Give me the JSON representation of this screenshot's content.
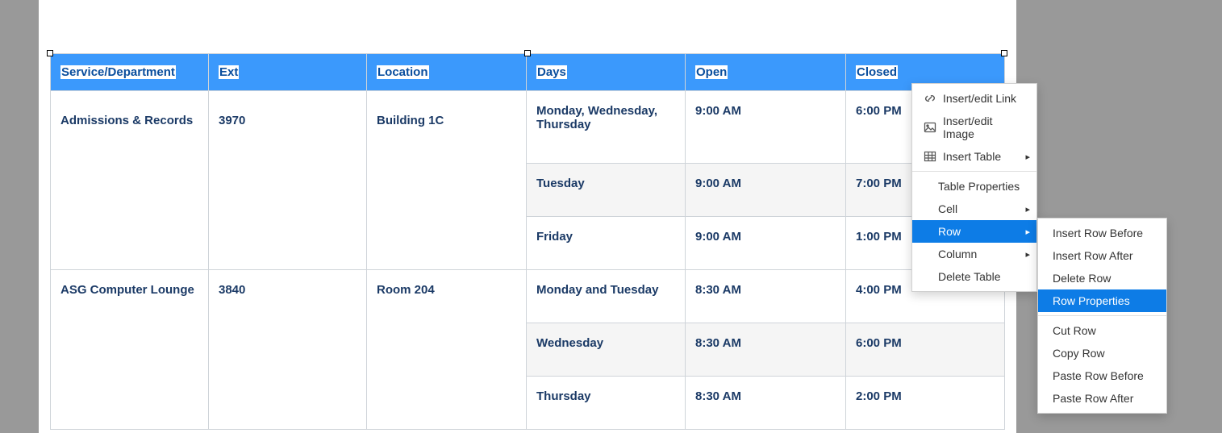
{
  "table": {
    "headers": [
      "Service/Department",
      "Ext",
      "Location",
      "Days",
      "Open",
      "Closed"
    ],
    "rows": [
      {
        "service": "Admissions & Records",
        "ext": "3970",
        "location": "Building 1C",
        "schedules": [
          {
            "days": "Monday, Wednesday, Thursday",
            "open": "9:00 AM",
            "closed": "6:00 PM"
          },
          {
            "days": "Tuesday",
            "open": "9:00 AM",
            "closed": "7:00 PM"
          },
          {
            "days": "Friday",
            "open": "9:00 AM",
            "closed": "1:00 PM"
          }
        ]
      },
      {
        "service": "ASG Computer Lounge",
        "ext": "3840",
        "location": "Room 204",
        "schedules": [
          {
            "days": "Monday and Tuesday",
            "open": "8:30 AM",
            "closed": "4:00 PM"
          },
          {
            "days": "Wednesday",
            "open": "8:30 AM",
            "closed": "6:00 PM"
          },
          {
            "days": "Thursday",
            "open": "8:30 AM",
            "closed": "2:00 PM"
          }
        ]
      }
    ]
  },
  "menu1": {
    "insertLink": "Insert/edit Link",
    "insertImage": "Insert/edit Image",
    "insertTable": "Insert Table",
    "tableProps": "Table Properties",
    "cell": "Cell",
    "row": "Row",
    "column": "Column",
    "deleteTable": "Delete Table"
  },
  "menu2": {
    "insertBefore": "Insert Row Before",
    "insertAfter": "Insert Row After",
    "deleteRow": "Delete Row",
    "rowProps": "Row Properties",
    "cutRow": "Cut Row",
    "copyRow": "Copy Row",
    "pasteBefore": "Paste Row Before",
    "pasteAfter": "Paste Row After"
  }
}
